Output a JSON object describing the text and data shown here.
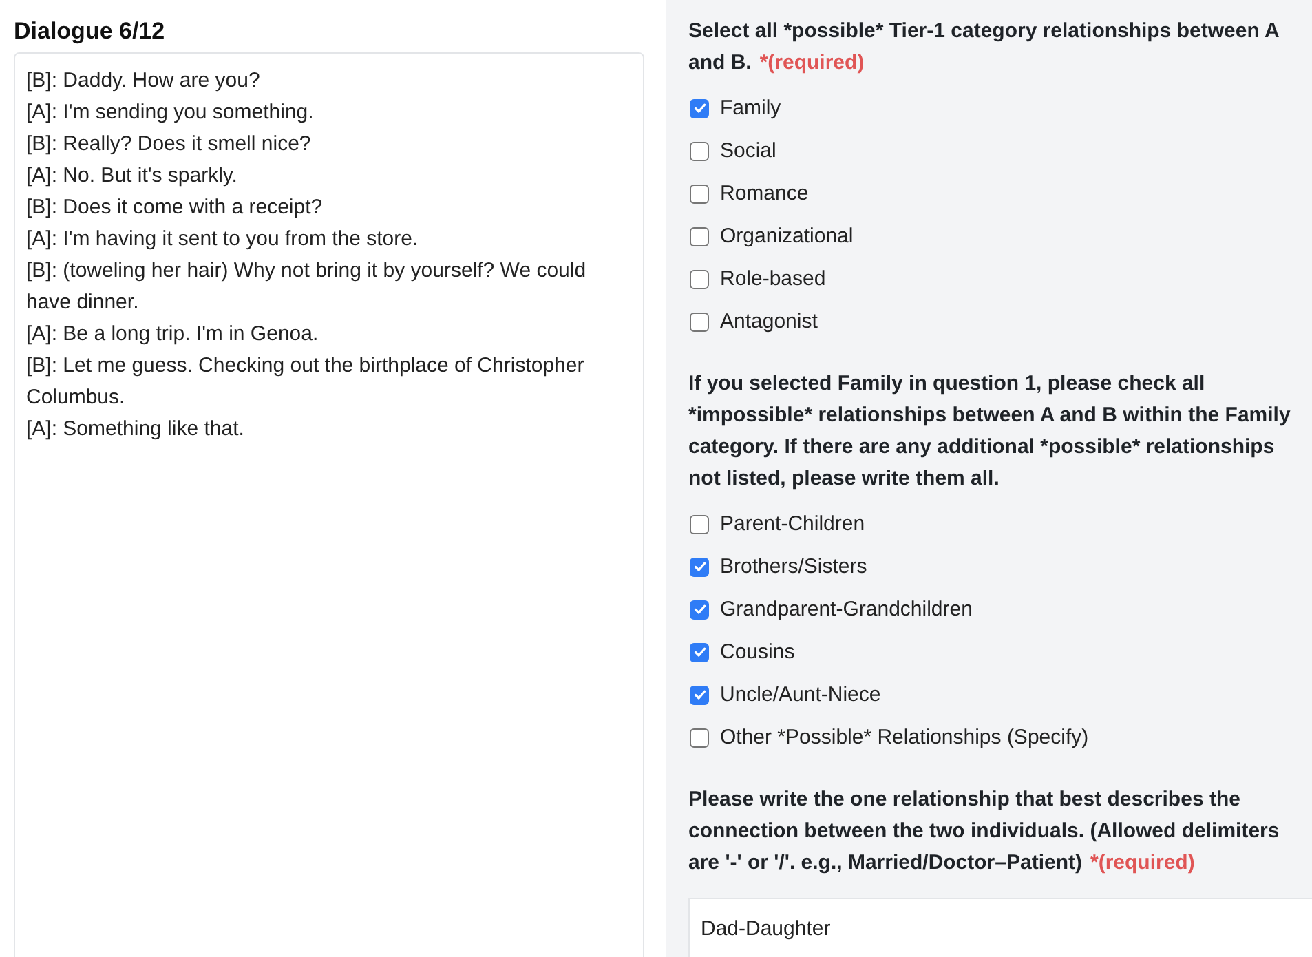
{
  "dialogue": {
    "title": "Dialogue 6/12",
    "lines": [
      "[B]: Daddy. How are you?",
      "[A]: I'm sending you something.",
      "[B]: Really? Does it smell nice?",
      "[A]: No. But it's sparkly.",
      "[B]: Does it come with a receipt?",
      "[A]: I'm having it sent to you from the store.",
      "[B]: (toweling her hair) Why not bring it by yourself? We could have dinner.",
      "[A]: Be a long trip. I'm in Genoa.",
      "[B]: Let me guess. Checking out the birthplace of Christopher Columbus.",
      "[A]: Something like that."
    ]
  },
  "questions": [
    {
      "kind": "checkboxes",
      "prompt": "Select all *possible* Tier-1 category relationships between A and B.",
      "required_label": "*(required)",
      "options": [
        {
          "label": "Family",
          "checked": true
        },
        {
          "label": "Social",
          "checked": false
        },
        {
          "label": "Romance",
          "checked": false
        },
        {
          "label": "Organizational",
          "checked": false
        },
        {
          "label": "Role-based",
          "checked": false
        },
        {
          "label": "Antagonist",
          "checked": false
        }
      ]
    },
    {
      "kind": "checkboxes",
      "prompt": "If you selected Family in question 1, please check all *impossible* relationships between A and B within the Family category. If there are any additional *possible* relationships not listed, please write them all.",
      "options": [
        {
          "label": "Parent-Children",
          "checked": false
        },
        {
          "label": "Brothers/Sisters",
          "checked": true
        },
        {
          "label": "Grandparent-Grandchildren",
          "checked": true
        },
        {
          "label": "Cousins",
          "checked": true
        },
        {
          "label": "Uncle/Aunt-Niece",
          "checked": true
        },
        {
          "label": "Other *Possible* Relationships (Specify)",
          "checked": false
        }
      ]
    },
    {
      "kind": "text",
      "prompt": "Please write the one relationship that best describes the connection between the two individuals. (Allowed delimiters are '-' or '/'. e.g., Married/Doctor–Patient)",
      "required_label": "*(required)",
      "value": "Dad-Daughter"
    }
  ]
}
